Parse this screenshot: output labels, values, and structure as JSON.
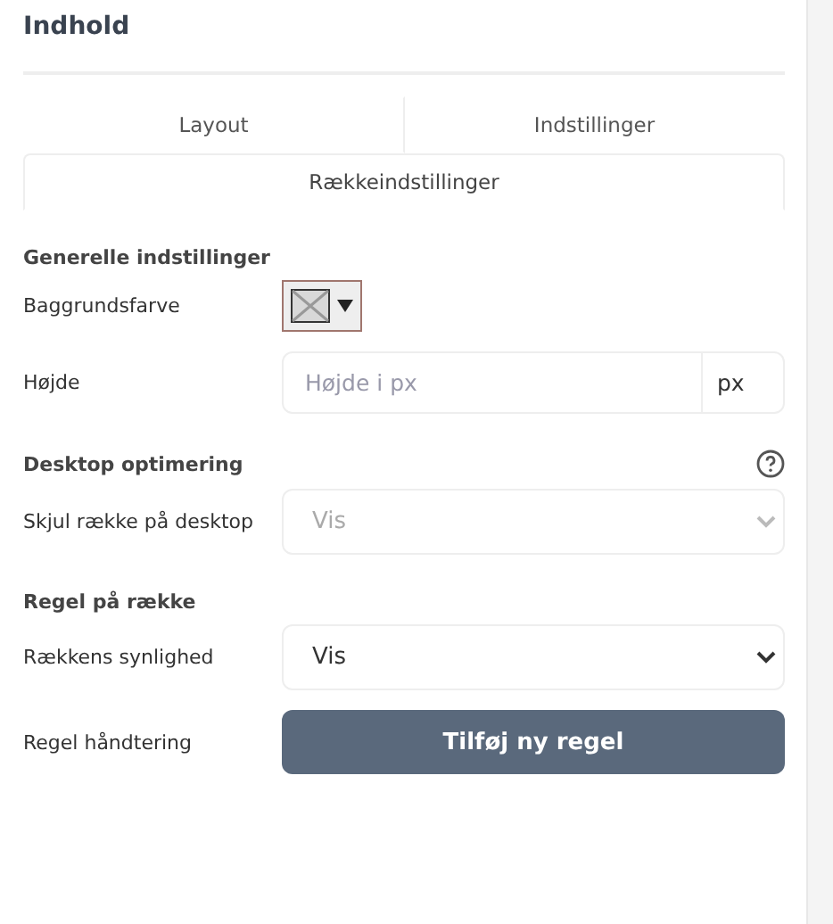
{
  "panel": {
    "title": "Indhold"
  },
  "tabs": [
    {
      "label": "Layout",
      "selected": false
    },
    {
      "label": "Indstillinger",
      "selected": false
    },
    {
      "label": "Rækkeindstillinger",
      "selected": true
    }
  ],
  "sections": [
    {
      "heading": "Generelle indstillinger",
      "help": false,
      "rows": [
        {
          "kind": "color",
          "label": "Baggrundsfarve"
        },
        {
          "kind": "input",
          "label": "Højde",
          "placeholder": "Højde i px",
          "unit": "px"
        }
      ]
    },
    {
      "heading": "Desktop optimering",
      "help": true,
      "rows": [
        {
          "kind": "select",
          "label": "Skjul række på desktop",
          "value": "Vis",
          "disabled": true
        }
      ]
    },
    {
      "heading": "Regel på række",
      "help": false,
      "rows": [
        {
          "kind": "select",
          "label": "Rækkens synlighed",
          "value": "Vis",
          "disabled": false
        },
        {
          "kind": "button",
          "label": "Regel håndtering",
          "text": "Tilføj ny regel"
        }
      ]
    }
  ]
}
